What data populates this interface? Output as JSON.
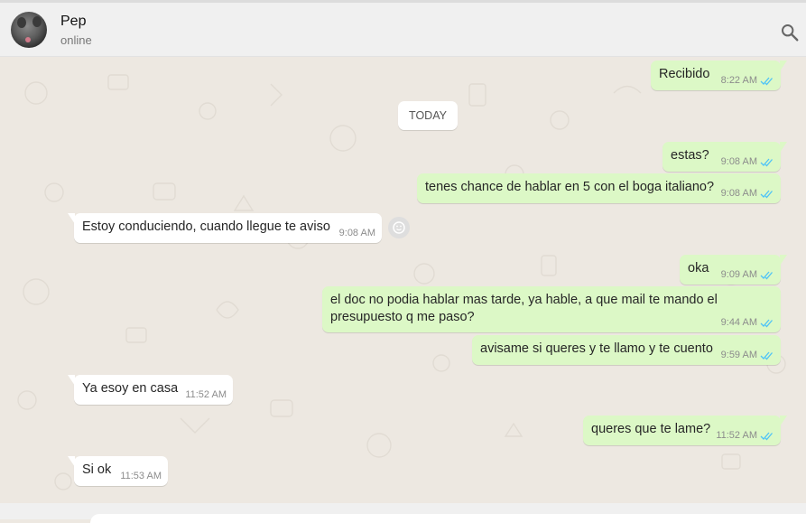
{
  "header": {
    "contact_name": "Pep",
    "status": "online",
    "avatar_icon": "dog-photo-avatar",
    "search_icon": "search-icon"
  },
  "chat": {
    "date_divider": "TODAY",
    "messages": [
      {
        "direction": "outgoing",
        "text": "Recibido",
        "time": "8:22 AM",
        "status": "read"
      },
      {
        "direction": "outgoing",
        "text": "estas?",
        "time": "9:08 AM",
        "status": "read"
      },
      {
        "direction": "outgoing",
        "text": "tenes chance de hablar en 5 con el boga italiano?",
        "time": "9:08 AM",
        "status": "read"
      },
      {
        "direction": "incoming",
        "text": "Estoy conduciendo, cuando llegue te aviso",
        "time": "9:08 AM"
      },
      {
        "direction": "outgoing",
        "text": "oka",
        "time": "9:09 AM",
        "status": "read"
      },
      {
        "direction": "outgoing",
        "text": "el doc no podia hablar mas tarde, ya hable, a que mail te mando el presupuesto q me paso?",
        "time": "9:44 AM",
        "status": "read"
      },
      {
        "direction": "outgoing",
        "text": "avisame si queres y te llamo y te cuento",
        "time": "9:59 AM",
        "status": "read"
      },
      {
        "direction": "incoming",
        "text": "Ya esoy en casa",
        "time": "11:52 AM"
      },
      {
        "direction": "outgoing",
        "text": "queres que te lame?",
        "time": "11:52 AM",
        "status": "read"
      },
      {
        "direction": "incoming",
        "text": "Si ok",
        "time": "11:53 AM"
      }
    ]
  },
  "colors": {
    "outgoing_bubble": "#dcf8c6",
    "incoming_bubble": "#ffffff",
    "read_ticks": "#4fc3f7",
    "chat_background": "#ede8e1"
  }
}
